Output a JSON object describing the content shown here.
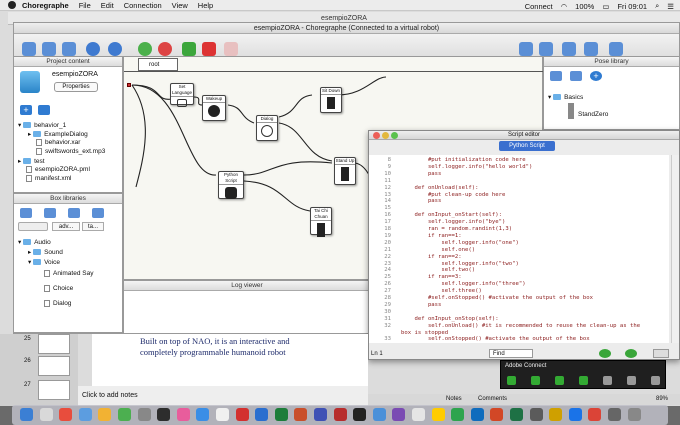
{
  "menubar": {
    "app": "Choregraphe",
    "items": [
      "File",
      "Edit",
      "Connection",
      "View",
      "Help"
    ],
    "connect": "Connect",
    "battery": "100%",
    "clock": "Fri 09:01"
  },
  "back_window_title": "esempioZORA",
  "window_title": "esempioZORA - Choregraphe (Connected to a virtual robot)",
  "project": {
    "title": "Project content",
    "name": "esempioZORA",
    "properties_label": "Properties",
    "tree": [
      {
        "label": "behavior_1",
        "kind": "folder"
      },
      {
        "label": "ExampleDialog",
        "kind": "folder"
      },
      {
        "label": "behavior.xar",
        "kind": "file"
      },
      {
        "label": "swiftswords_ext.mp3",
        "kind": "file"
      },
      {
        "label": "test",
        "kind": "folder"
      },
      {
        "label": "esempioZORA.pml",
        "kind": "file"
      },
      {
        "label": "manifest.xml",
        "kind": "file"
      }
    ]
  },
  "box_libraries": {
    "title": "Box libraries",
    "tabs": [
      "adv...",
      "ta..."
    ],
    "tree": [
      "Audio",
      "Sound",
      "Voice",
      "Animated Say",
      "Choice",
      "Dialog"
    ]
  },
  "canvas": {
    "breadcrumb": "root",
    "nodes": [
      "Set Language",
      "Wakeup",
      "Dialog",
      "Python Script",
      "Sit Down",
      "Stand Up",
      "Tai Chi Chuan"
    ]
  },
  "log_viewer": {
    "title": "Log viewer"
  },
  "pose_library": {
    "title": "Pose library",
    "group": "Basics",
    "item": "StandZero"
  },
  "script_editor": {
    "title": "Script editor",
    "tab": "Python Script",
    "lines": [
      {
        "n": "8",
        "code": "        #put initialization code here"
      },
      {
        "n": "9",
        "code": "        self.logger.info(\"hello world\")"
      },
      {
        "n": "10",
        "code": "        pass"
      },
      {
        "n": "11",
        "code": ""
      },
      {
        "n": "12",
        "code": "    def onUnload(self):"
      },
      {
        "n": "13",
        "code": "        #put clean-up code here"
      },
      {
        "n": "14",
        "code": "        pass"
      },
      {
        "n": "15",
        "code": ""
      },
      {
        "n": "16",
        "code": "    def onInput_onStart(self):"
      },
      {
        "n": "17",
        "code": "        self.logger.info(\"bye\")"
      },
      {
        "n": "18",
        "code": "        ran = random.randint(1,3)"
      },
      {
        "n": "19",
        "code": "        if ran==1:"
      },
      {
        "n": "20",
        "code": "            self.logger.info(\"one\")"
      },
      {
        "n": "21",
        "code": "            self.one()"
      },
      {
        "n": "22",
        "code": "        if ran==2:"
      },
      {
        "n": "23",
        "code": "            self.logger.info(\"two\")"
      },
      {
        "n": "24",
        "code": "            self.two()"
      },
      {
        "n": "25",
        "code": "        if ran==3:"
      },
      {
        "n": "26",
        "code": "            self.logger.info(\"three\")"
      },
      {
        "n": "27",
        "code": "            self.three()"
      },
      {
        "n": "28",
        "code": "        #self.onStopped() #activate the output of the box"
      },
      {
        "n": "29",
        "code": "        pass"
      },
      {
        "n": "30",
        "code": ""
      },
      {
        "n": "31",
        "code": "    def onInput_onStop(self):"
      },
      {
        "n": "32",
        "code": "        self.onUnload() #it is recommended to reuse the clean-up as the"
      },
      {
        "n": "",
        "code": "box is stopped"
      },
      {
        "n": "33",
        "code": "        self.onStopped() #activate the output of the box"
      }
    ],
    "status_line": "Ln 1",
    "find_label": "Find"
  },
  "slides": {
    "numbers": [
      "25",
      "26",
      "27"
    ],
    "main_text_1": "Built on top of NAO, it is an interactive and",
    "main_text_2": "completely programmable humanoid robot",
    "notes_placeholder": "Click to add notes"
  },
  "statusbar": {
    "notes": "Notes",
    "comments": "Comments",
    "zoom": "89%"
  },
  "adobe_connect": {
    "title": "Adobe Connect"
  },
  "colors": {
    "accent": "#3b7fd4",
    "python_tab": "#3a6fcf"
  }
}
